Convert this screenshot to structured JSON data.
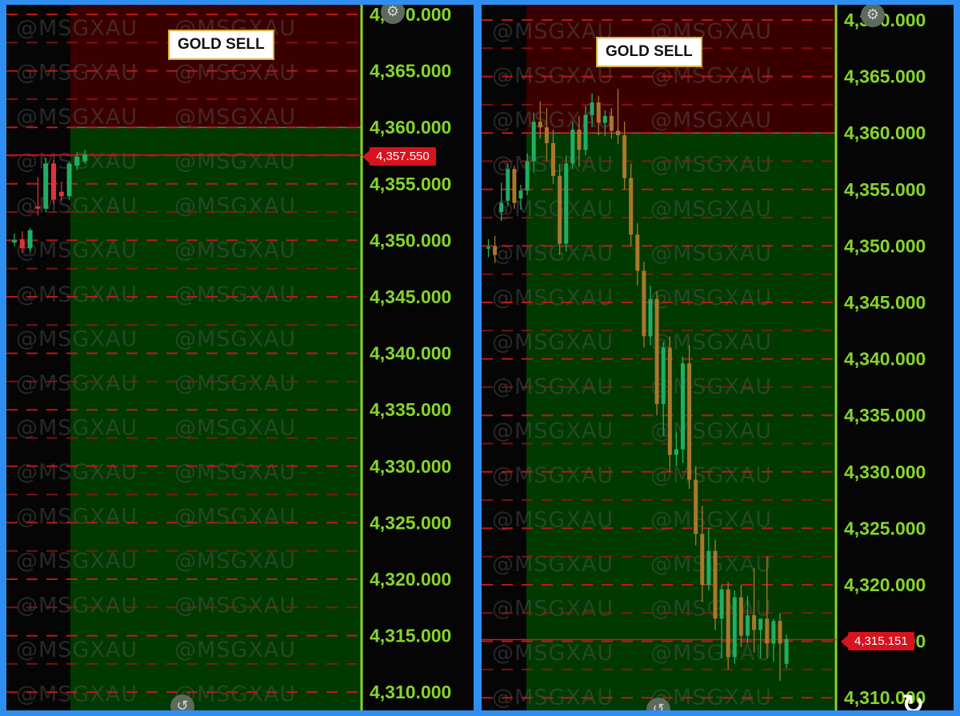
{
  "colors": {
    "frame": "#2f8ff0",
    "sell_zone": "#3a0000",
    "profit_zone": "#003a00",
    "axis": "#86d42c",
    "bull": "#1fae63",
    "bear_left": "#e0323a",
    "bear_right": "#a9782b",
    "level_line": "#c21a1a"
  },
  "icons": {
    "top": "gear-icon",
    "bottom_left": "reset-icon",
    "bottom_right": "refresh-icon"
  },
  "chart_data": [
    {
      "type": "candlestick",
      "title": "GOLD SELL",
      "watermark": "@MSGXAU",
      "y_ticks": [
        "4,370.000",
        "4,365.000",
        "4,360.000",
        "4,355.000",
        "4,350.000",
        "4,345.000",
        "4,340.000",
        "4,335.000",
        "4,330.000",
        "4,325.000",
        "4,320.000",
        "4,315.000",
        "4,310.000"
      ],
      "ylim": [
        4309,
        4371
      ],
      "sell_zone": [
        4360,
        4371
      ],
      "profit_zone": [
        4309,
        4360
      ],
      "current_price_label": "4,357.550",
      "current_price": 4357.55,
      "candles": [
        {
          "o": 4349.8,
          "h": 4350.6,
          "l": 4349.5,
          "c": 4350.0
        },
        {
          "o": 4350.1,
          "h": 4350.8,
          "l": 4348.9,
          "c": 4349.3
        },
        {
          "o": 4349.3,
          "h": 4351.1,
          "l": 4349.0,
          "c": 4350.9
        },
        {
          "o": 4353.0,
          "h": 4355.6,
          "l": 4352.2,
          "c": 4352.8
        },
        {
          "o": 4352.8,
          "h": 4357.3,
          "l": 4352.5,
          "c": 4356.8
        },
        {
          "o": 4356.8,
          "h": 4357.1,
          "l": 4353.2,
          "c": 4353.6
        },
        {
          "o": 4354.3,
          "h": 4355.2,
          "l": 4353.5,
          "c": 4353.9
        },
        {
          "o": 4353.9,
          "h": 4357.0,
          "l": 4353.6,
          "c": 4356.8
        },
        {
          "o": 4356.6,
          "h": 4357.8,
          "l": 4356.2,
          "c": 4357.4
        },
        {
          "o": 4357.0,
          "h": 4358.0,
          "l": 4356.8,
          "c": 4357.6
        }
      ]
    },
    {
      "type": "candlestick",
      "title": "GOLD SELL",
      "watermark": "@MSGXAU",
      "y_ticks": [
        "4,370.000",
        "4,365.000",
        "4,360.000",
        "4,355.000",
        "4,350.000",
        "4,345.000",
        "4,340.000",
        "4,335.000",
        "4,330.000",
        "4,325.000",
        "4,320.000",
        "4,315.000",
        "4,310.000"
      ],
      "ylim": [
        4309,
        4371
      ],
      "sell_zone": [
        4360,
        4371
      ],
      "profit_zone": [
        4309,
        4360
      ],
      "current_price_label": "4,315.151",
      "current_price": 4315.15,
      "candles": [
        {
          "o": 4349.8,
          "h": 4350.6,
          "l": 4349.0,
          "c": 4349.9
        },
        {
          "o": 4350.0,
          "h": 4350.9,
          "l": 4348.5,
          "c": 4349.2
        },
        {
          "o": 4353.0,
          "h": 4355.6,
          "l": 4352.2,
          "c": 4353.8
        },
        {
          "o": 4354.0,
          "h": 4357.3,
          "l": 4353.5,
          "c": 4356.8
        },
        {
          "o": 4356.8,
          "h": 4357.1,
          "l": 4353.3,
          "c": 4353.8
        },
        {
          "o": 4354.2,
          "h": 4355.4,
          "l": 4353.2,
          "c": 4354.9
        },
        {
          "o": 4354.9,
          "h": 4358.2,
          "l": 4354.5,
          "c": 4357.5
        },
        {
          "o": 4357.5,
          "h": 4361.8,
          "l": 4356.5,
          "c": 4361.0
        },
        {
          "o": 4361.0,
          "h": 4362.8,
          "l": 4359.5,
          "c": 4360.5
        },
        {
          "o": 4360.5,
          "h": 4362.2,
          "l": 4357.5,
          "c": 4359.1
        },
        {
          "o": 4359.1,
          "h": 4360.3,
          "l": 4355.5,
          "c": 4356.2
        },
        {
          "o": 4356.2,
          "h": 4357.2,
          "l": 4349.2,
          "c": 4350.2
        },
        {
          "o": 4350.2,
          "h": 4358.0,
          "l": 4349.5,
          "c": 4357.3
        },
        {
          "o": 4357.3,
          "h": 4361.0,
          "l": 4356.8,
          "c": 4360.3
        },
        {
          "o": 4360.3,
          "h": 4361.5,
          "l": 4357.0,
          "c": 4358.5
        },
        {
          "o": 4358.5,
          "h": 4362.4,
          "l": 4358.0,
          "c": 4361.6
        },
        {
          "o": 4361.6,
          "h": 4363.5,
          "l": 4360.5,
          "c": 4362.7
        },
        {
          "o": 4362.7,
          "h": 4363.3,
          "l": 4359.8,
          "c": 4360.9
        },
        {
          "o": 4360.9,
          "h": 4362.0,
          "l": 4359.7,
          "c": 4361.5
        },
        {
          "o": 4361.5,
          "h": 4362.2,
          "l": 4359.5,
          "c": 4360.2
        },
        {
          "o": 4360.2,
          "h": 4363.9,
          "l": 4359.0,
          "c": 4359.8
        },
        {
          "o": 4359.8,
          "h": 4361.0,
          "l": 4355.0,
          "c": 4356.0
        },
        {
          "o": 4356.0,
          "h": 4357.3,
          "l": 4350.0,
          "c": 4351.0
        },
        {
          "o": 4351.0,
          "h": 4352.0,
          "l": 4346.5,
          "c": 4347.8
        },
        {
          "o": 4347.8,
          "h": 4348.6,
          "l": 4341.0,
          "c": 4342.0
        },
        {
          "o": 4342.0,
          "h": 4346.5,
          "l": 4341.2,
          "c": 4345.3
        },
        {
          "o": 4345.3,
          "h": 4346.0,
          "l": 4335.0,
          "c": 4336.0
        },
        {
          "o": 4336.0,
          "h": 4341.5,
          "l": 4333.2,
          "c": 4341.0
        },
        {
          "o": 4341.0,
          "h": 4342.0,
          "l": 4330.0,
          "c": 4331.5
        },
        {
          "o": 4331.5,
          "h": 4333.5,
          "l": 4330.5,
          "c": 4332.0
        },
        {
          "o": 4332.0,
          "h": 4340.2,
          "l": 4330.8,
          "c": 4339.6
        },
        {
          "o": 4339.6,
          "h": 4341.2,
          "l": 4328.5,
          "c": 4329.3
        },
        {
          "o": 4329.3,
          "h": 4330.5,
          "l": 4323.5,
          "c": 4324.5
        },
        {
          "o": 4324.5,
          "h": 4327.0,
          "l": 4318.5,
          "c": 4320.0
        },
        {
          "o": 4320.0,
          "h": 4325.0,
          "l": 4319.5,
          "c": 4323.0
        },
        {
          "o": 4323.0,
          "h": 4324.0,
          "l": 4316.0,
          "c": 4317.0
        },
        {
          "o": 4317.0,
          "h": 4320.0,
          "l": 4313.5,
          "c": 4319.6
        },
        {
          "o": 4319.6,
          "h": 4320.2,
          "l": 4312.5,
          "c": 4313.6
        },
        {
          "o": 4313.6,
          "h": 4319.5,
          "l": 4313.0,
          "c": 4318.9
        },
        {
          "o": 4318.9,
          "h": 4320.0,
          "l": 4314.5,
          "c": 4315.5
        },
        {
          "o": 4315.5,
          "h": 4319.0,
          "l": 4314.8,
          "c": 4317.3
        },
        {
          "o": 4317.3,
          "h": 4321.5,
          "l": 4314.0,
          "c": 4316.0
        },
        {
          "o": 4316.0,
          "h": 4317.0,
          "l": 4313.5,
          "c": 4317.0
        },
        {
          "o": 4317.0,
          "h": 4322.5,
          "l": 4313.5,
          "c": 4314.8
        },
        {
          "o": 4314.8,
          "h": 4317.0,
          "l": 4313.2,
          "c": 4316.8
        },
        {
          "o": 4316.8,
          "h": 4317.5,
          "l": 4311.5,
          "c": 4314.8
        },
        {
          "o": 4313.0,
          "h": 4315.6,
          "l": 4312.6,
          "c": 4315.2
        }
      ]
    }
  ]
}
